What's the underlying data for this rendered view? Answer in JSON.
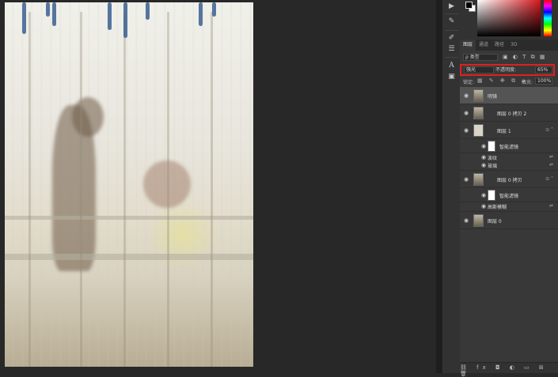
{
  "toolstrip": {
    "play_icon": "▶",
    "icons": [
      "play-icon",
      "eyedropper-icon",
      "brush-icon",
      "sliders-icon",
      "text-icon",
      "mask-icon"
    ]
  },
  "panel_tabs": [
    "图层",
    "通道",
    "路径",
    "3D"
  ],
  "filter": {
    "kind_label": "ρ 类型"
  },
  "blend": {
    "mode": "强光",
    "opacity_label": "不透明度:",
    "opacity_value": "65%"
  },
  "lock": {
    "label": "锁定:",
    "fill_label": "填充:",
    "fill_value": "100%"
  },
  "layers": [
    {
      "name": "明镜",
      "type": "layer",
      "selected": true
    },
    {
      "name": "图层 0 拷贝 2",
      "type": "layer"
    },
    {
      "name": "图层 1",
      "type": "smart"
    },
    {
      "name": "智能滤镜",
      "type": "filter-group"
    },
    {
      "name": "波纹",
      "type": "filter"
    },
    {
      "name": "玻璃",
      "type": "filter"
    },
    {
      "name": "图层 0 拷贝",
      "type": "smart"
    },
    {
      "name": "智能滤镜",
      "type": "filter-group"
    },
    {
      "name": "高斯模糊",
      "type": "filter"
    },
    {
      "name": "图层 0",
      "type": "layer"
    }
  ],
  "colors": {
    "highlight": "#e02020",
    "panel_bg": "#383838",
    "canvas_bg": "#282828"
  }
}
